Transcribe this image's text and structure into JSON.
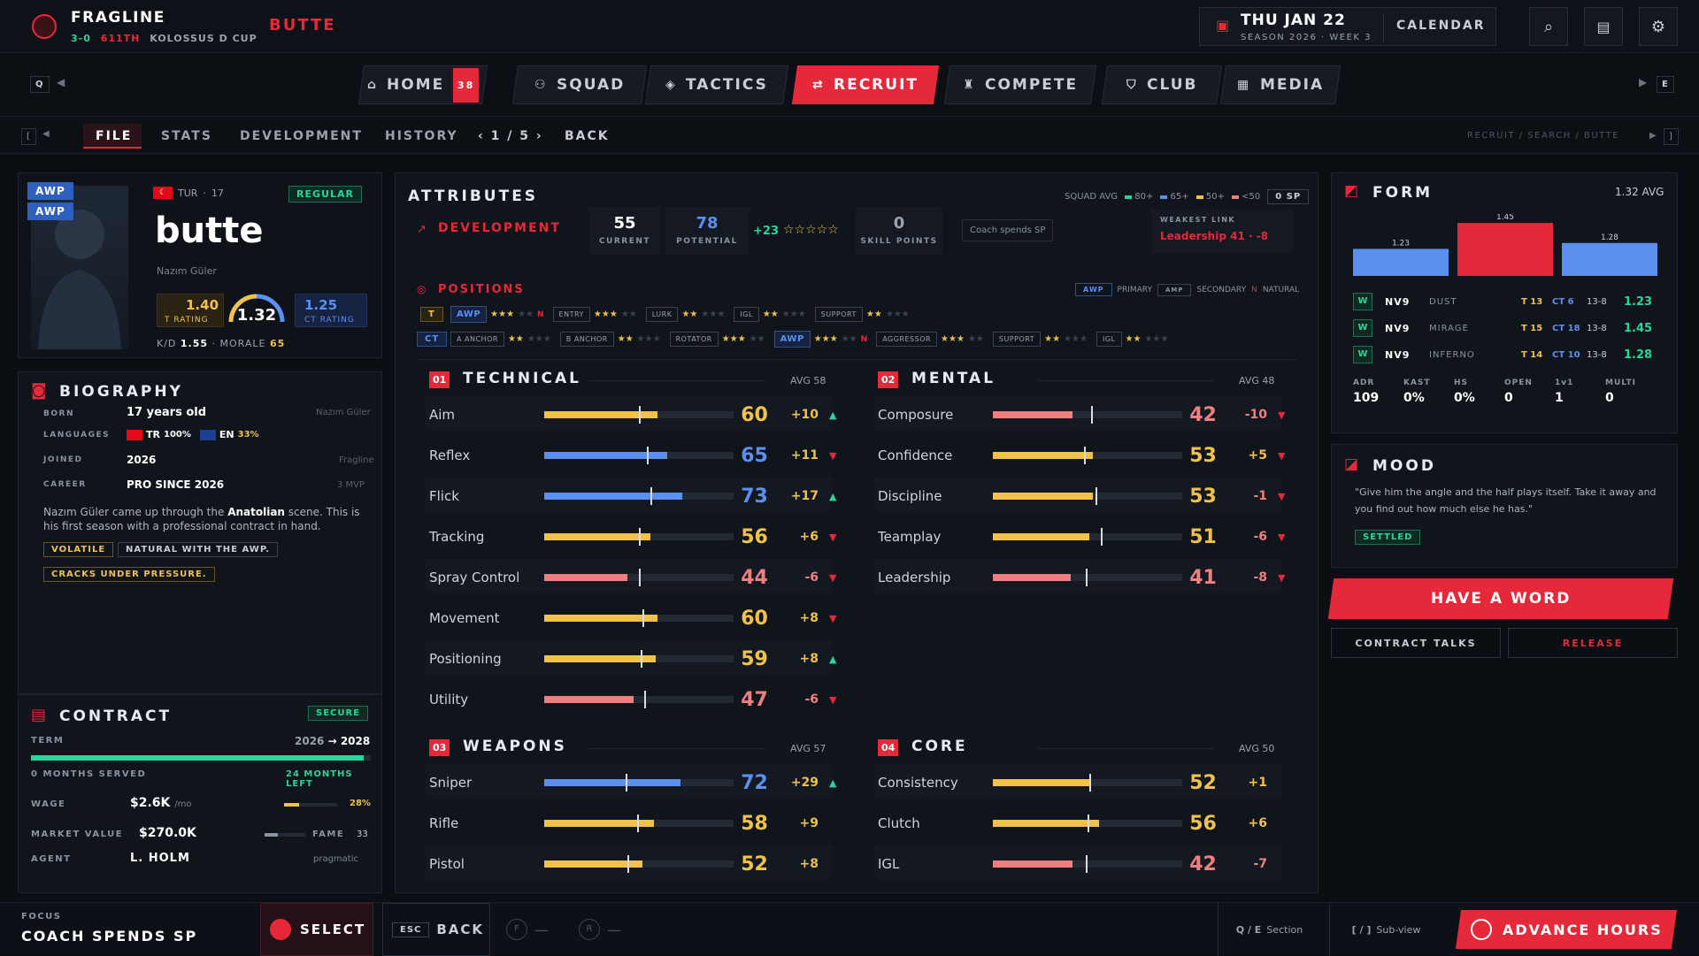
{
  "top": {
    "club": "FRAGLINE",
    "record": "3-0",
    "rank": "611TH",
    "cup": "KOLOSSUS D CUP",
    "player": "BUTTE",
    "date": "THU JAN 22",
    "season": "SEASON 2026 · WEEK 3",
    "calendar": "CALENDAR"
  },
  "nav": {
    "q": "Q",
    "e": "E",
    "tabs": [
      {
        "label": "HOME",
        "badge": "38"
      },
      {
        "label": "SQUAD"
      },
      {
        "label": "TACTICS"
      },
      {
        "label": "RECRUIT"
      },
      {
        "label": "COMPETE"
      },
      {
        "label": "CLUB"
      },
      {
        "label": "MEDIA"
      }
    ]
  },
  "sub": {
    "open": "[",
    "close": "]",
    "tabs": [
      "FILE",
      "STATS",
      "DEVELOPMENT",
      "HISTORY"
    ],
    "pager": "1 / 5",
    "back": "BACK",
    "breadcrumb": "RECRUIT / SEARCH / BUTTE"
  },
  "player": {
    "role1": "AWP",
    "role2": "AWP",
    "nation": "TUR",
    "age": "17",
    "status": "REGULAR",
    "name": "butte",
    "realname": "Nazım Güler",
    "t_rating": "1.40",
    "t_rating_label": "T RATING",
    "rating": "1.32",
    "ct_rating": "1.25",
    "ct_rating_label": "CT RATING",
    "kd_label": "K/D",
    "kd": "1.55",
    "morale_label": "MORALE",
    "morale": "65"
  },
  "bio": {
    "title": "BIOGRAPHY",
    "born_label": "BORN",
    "born": "17 years old",
    "born_note": "Nazım Güler",
    "lang_label": "LANGUAGES",
    "lang1": "TR",
    "lang1_pct": "100%",
    "lang2": "EN",
    "lang2_pct": "33%",
    "joined_label": "JOINED",
    "joined": "2026",
    "joined_note": "Fragline",
    "career_label": "CAREER",
    "career": "PRO SINCE 2026",
    "career_note": "3 MVP",
    "text1": "Nazım Güler came up through the ",
    "text_bold": "Anatolian",
    "text2": " scene. This is his first season with a professional contract in hand.",
    "tags": [
      "VOLATILE",
      "NATURAL WITH THE AWP.",
      "CRACKS UNDER PRESSURE."
    ]
  },
  "contract": {
    "title": "CONTRACT",
    "status": "SECURE",
    "term_label": "TERM",
    "term_from": "2026",
    "term_to": "2028",
    "served": "0 MONTHS SERVED",
    "left": "24 MONTHS LEFT",
    "wage_label": "WAGE",
    "wage": "$2.6K",
    "wage_unit": "/mo",
    "wage_pct": "28%",
    "mv_label": "MARKET VALUE",
    "mv": "$270.0K",
    "fame_label": "FAME",
    "fame": "33",
    "agent_label": "AGENT",
    "agent": "L. HOLM",
    "agent_note": "pragmatic",
    "term_progress": 0.98,
    "wage_fill": 0.28,
    "fame_fill": 0.33
  },
  "attributes": {
    "title": "ATTRIBUTES",
    "squad_avg": "SQUAD AVG",
    "legend": [
      "80+",
      "65+",
      "50+",
      "<50"
    ],
    "sp": "0 SP",
    "dev_title": "DEVELOPMENT",
    "current": "55",
    "current_label": "CURRENT",
    "potential": "78",
    "potential_label": "POTENTIAL",
    "gain": "+23",
    "sp_val": "0",
    "sp_label": "SKILL POINTS",
    "coach_note": "Coach spends SP",
    "weak_label": "WEAKEST LINK",
    "weak_val": "Leadership 41 · -8",
    "stars": "☆☆☆☆☆"
  },
  "positions": {
    "title": "POSITIONS",
    "legend_awp": "AWP",
    "legend_primary": "PRIMARY",
    "legend_amp": "AMP",
    "legend_secondary": "SECONDARY",
    "legend_n": "N",
    "legend_natural": "NATURAL",
    "t_label": "T",
    "ct_label": "CT",
    "t_roles": [
      {
        "n": "AWP",
        "s": "★★★",
        "e": "★★",
        "flag": "N"
      },
      {
        "n": "ENTRY",
        "s": "★★★",
        "e": "★★"
      },
      {
        "n": "LURK",
        "s": "★★",
        "e": "★★★"
      },
      {
        "n": "IGL",
        "s": "★★",
        "e": "★★★"
      },
      {
        "n": "SUPPORT",
        "s": "★★",
        "e": "★★★"
      }
    ],
    "ct_roles": [
      {
        "n": "A ANCHOR",
        "s": "★★",
        "e": "★★★"
      },
      {
        "n": "B ANCHOR",
        "s": "★★",
        "e": "★★★"
      },
      {
        "n": "ROTATOR",
        "s": "★★★",
        "e": "★★"
      },
      {
        "n": "AWP",
        "s": "★★★",
        "e": "★★",
        "flag": "N"
      },
      {
        "n": "AGGRESSOR",
        "s": "★★★",
        "e": "★★"
      },
      {
        "n": "SUPPORT",
        "s": "★★",
        "e": "★★★"
      },
      {
        "n": "IGL",
        "s": "★★",
        "e": "★★★"
      }
    ]
  },
  "technical": {
    "num": "01",
    "title": "TECHNICAL",
    "avg": "AVG 58",
    "rows": [
      {
        "name": "Aim",
        "value": "60",
        "delta": "+10",
        "dir": "▲",
        "fill": 0.6,
        "avg": 0.5,
        "color": "#f0c14b"
      },
      {
        "name": "Reflex",
        "value": "65",
        "delta": "+11",
        "dir": "▼",
        "fill": 0.65,
        "avg": 0.54,
        "color": "#5b8ff0"
      },
      {
        "name": "Flick",
        "value": "73",
        "delta": "+17",
        "dir": "▲",
        "fill": 0.73,
        "avg": 0.56,
        "color": "#5b8ff0"
      },
      {
        "name": "Tracking",
        "value": "56",
        "delta": "+6",
        "dir": "▼",
        "fill": 0.56,
        "avg": 0.5,
        "color": "#f0c14b"
      },
      {
        "name": "Spray Control",
        "value": "44",
        "delta": "-6",
        "dir": "▼",
        "fill": 0.44,
        "avg": 0.5,
        "color": "#f08080"
      },
      {
        "name": "Movement",
        "value": "60",
        "delta": "+8",
        "dir": "▼",
        "fill": 0.6,
        "avg": 0.52,
        "color": "#f0c14b"
      },
      {
        "name": "Positioning",
        "value": "59",
        "delta": "+8",
        "dir": "▲",
        "fill": 0.59,
        "avg": 0.51,
        "color": "#f0c14b"
      },
      {
        "name": "Utility",
        "value": "47",
        "delta": "-6",
        "dir": "▼",
        "fill": 0.47,
        "avg": 0.53,
        "color": "#f08080"
      }
    ]
  },
  "mental": {
    "num": "02",
    "title": "MENTAL",
    "avg": "AVG 48",
    "rows": [
      {
        "name": "Composure",
        "value": "42",
        "delta": "-10",
        "dir": "▼",
        "fill": 0.42,
        "avg": 0.52,
        "color": "#f08080"
      },
      {
        "name": "Confidence",
        "value": "53",
        "delta": "+5",
        "dir": "▼",
        "fill": 0.53,
        "avg": 0.48,
        "color": "#f0c14b"
      },
      {
        "name": "Discipline",
        "value": "53",
        "delta": "-1",
        "dir": "▼",
        "fill": 0.53,
        "avg": 0.54,
        "color": "#f0c14b"
      },
      {
        "name": "Teamplay",
        "value": "51",
        "delta": "-6",
        "dir": "▼",
        "fill": 0.51,
        "avg": 0.57,
        "color": "#f0c14b"
      },
      {
        "name": "Leadership",
        "value": "41",
        "delta": "-8",
        "dir": "▼",
        "fill": 0.41,
        "avg": 0.49,
        "color": "#f08080"
      }
    ]
  },
  "weapons": {
    "num": "03",
    "title": "WEAPONS",
    "avg": "AVG 57",
    "rows": [
      {
        "name": "Sniper",
        "value": "72",
        "delta": "+29",
        "dir": "▲",
        "fill": 0.72,
        "avg": 0.43,
        "color": "#5b8ff0"
      },
      {
        "name": "Rifle",
        "value": "58",
        "delta": "+9",
        "dir": "",
        "fill": 0.58,
        "avg": 0.49,
        "color": "#f0c14b"
      },
      {
        "name": "Pistol",
        "value": "52",
        "delta": "+8",
        "dir": "",
        "fill": 0.52,
        "avg": 0.44,
        "color": "#f0c14b"
      }
    ]
  },
  "core": {
    "num": "04",
    "title": "CORE",
    "avg": "AVG 50",
    "rows": [
      {
        "name": "Consistency",
        "value": "52",
        "delta": "+1",
        "dir": "",
        "fill": 0.52,
        "avg": 0.51,
        "color": "#f0c14b"
      },
      {
        "name": "Clutch",
        "value": "56",
        "delta": "+6",
        "dir": "",
        "fill": 0.56,
        "avg": 0.5,
        "color": "#f0c14b"
      },
      {
        "name": "IGL",
        "value": "42",
        "delta": "-7",
        "dir": "",
        "fill": 0.42,
        "avg": 0.49,
        "color": "#f08080"
      }
    ]
  },
  "form": {
    "title": "FORM",
    "avg": "1.32 AVG",
    "chart_data": {
      "type": "bar",
      "categories": [
        "DUST",
        "MIRAGE",
        "INFERNO"
      ],
      "values": [
        1.23,
        1.45,
        1.28
      ],
      "colors": [
        "#5b8ff0",
        "#e5283a",
        "#5b8ff0"
      ]
    },
    "matches": [
      {
        "res": "W",
        "opp": "NV9",
        "map": "DUST",
        "t": "T 13",
        "ct": "CT 6",
        "score": "13-8",
        "rating": "1.23"
      },
      {
        "res": "W",
        "opp": "NV9",
        "map": "MIRAGE",
        "t": "T 15",
        "ct": "CT 18",
        "score": "13-8",
        "rating": "1.45"
      },
      {
        "res": "W",
        "opp": "NV9",
        "map": "INFERNO",
        "t": "T 14",
        "ct": "CT 10",
        "score": "13-8",
        "rating": "1.28"
      }
    ],
    "stats": [
      {
        "l": "ADR",
        "v": "109"
      },
      {
        "l": "KAST",
        "v": "0%"
      },
      {
        "l": "HS",
        "v": "0%"
      },
      {
        "l": "OPEN",
        "v": "0"
      },
      {
        "l": "1v1",
        "v": "1"
      },
      {
        "l": "MULTI",
        "v": "0"
      }
    ]
  },
  "mood": {
    "title": "MOOD",
    "quote": "\"Give him the angle and the half plays itself. Take it away and you find out how much else he has.\"",
    "status": "SETTLED"
  },
  "actions": {
    "word": "HAVE A WORD",
    "contract": "CONTRACT TALKS",
    "release": "RELEASE"
  },
  "bottom": {
    "focus_label": "FOCUS",
    "focus": "COACH SPENDS SP",
    "select": "SELECT",
    "esc": "ESC",
    "back": "BACK",
    "f": "F",
    "r": "R",
    "dash": "—",
    "qe": "Q / E",
    "section": "Section",
    "brackets": "[ / ]",
    "subview": "Sub-view",
    "advance": "ADVANCE HOURS"
  }
}
